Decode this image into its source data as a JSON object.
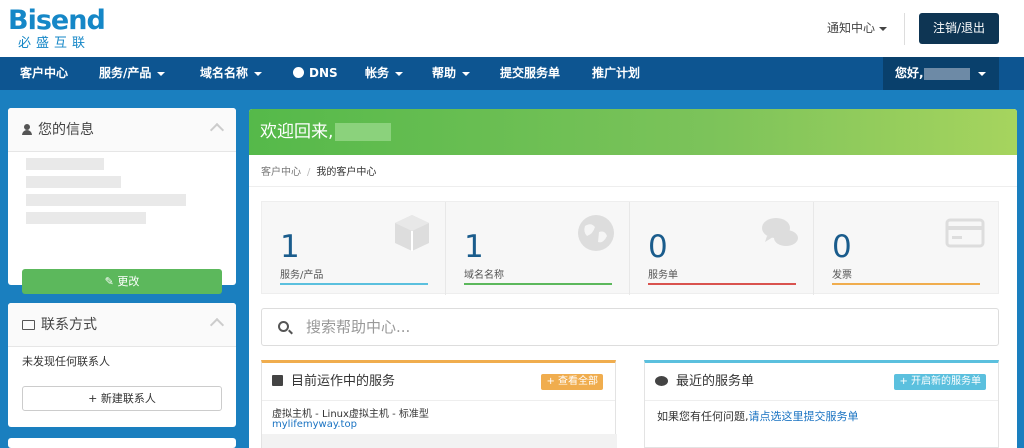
{
  "header": {
    "logo_text": "Bisend",
    "logo_sub": "必盛互联",
    "notify_label": "通知中心",
    "logout_label": "注销/退出"
  },
  "nav": {
    "items": [
      {
        "label": "客户中心"
      },
      {
        "label": "服务/产品"
      },
      {
        "label": "域名名称"
      },
      {
        "label": "DNS"
      },
      {
        "label": "帐务"
      },
      {
        "label": "帮助"
      },
      {
        "label": "提交服务单"
      },
      {
        "label": "推广计划"
      }
    ],
    "user_greeting": "您好,"
  },
  "sidebar": {
    "info_title": "您的信息",
    "edit_label": "更改",
    "contacts_title": "联系方式",
    "no_contacts_text": "未发现任何联系人",
    "new_contact_label": "新建联系人"
  },
  "main": {
    "welcome": "欢迎回来,",
    "breadcrumb": [
      "客户中心",
      "我的客户中心"
    ],
    "stats": [
      {
        "value": "1",
        "label": "服务/产品",
        "color": "#5bc0de",
        "icon": "box-icon"
      },
      {
        "value": "1",
        "label": "域名名称",
        "color": "#5cb85c",
        "icon": "globe-icon"
      },
      {
        "value": "0",
        "label": "服务单",
        "color": "#d9534f",
        "icon": "comments-icon"
      },
      {
        "value": "0",
        "label": "发票",
        "color": "#f0ad4e",
        "icon": "credit-card-icon"
      }
    ],
    "search_placeholder": "搜索帮助中心...",
    "services_card": {
      "title": "目前运作中的服务",
      "button": "查看全部",
      "button_color": "#f0ad4e",
      "service_line": "虚拟主机 - Linux虚拟主机 - 标准型",
      "service_domain": "mylifemyway.top"
    },
    "tickets_card": {
      "title": "最近的服务单",
      "button": "开启新的服务单",
      "button_color": "#5bc0de",
      "text": "如果您有任何问题,",
      "link": "请点选这里提交服务单"
    }
  }
}
